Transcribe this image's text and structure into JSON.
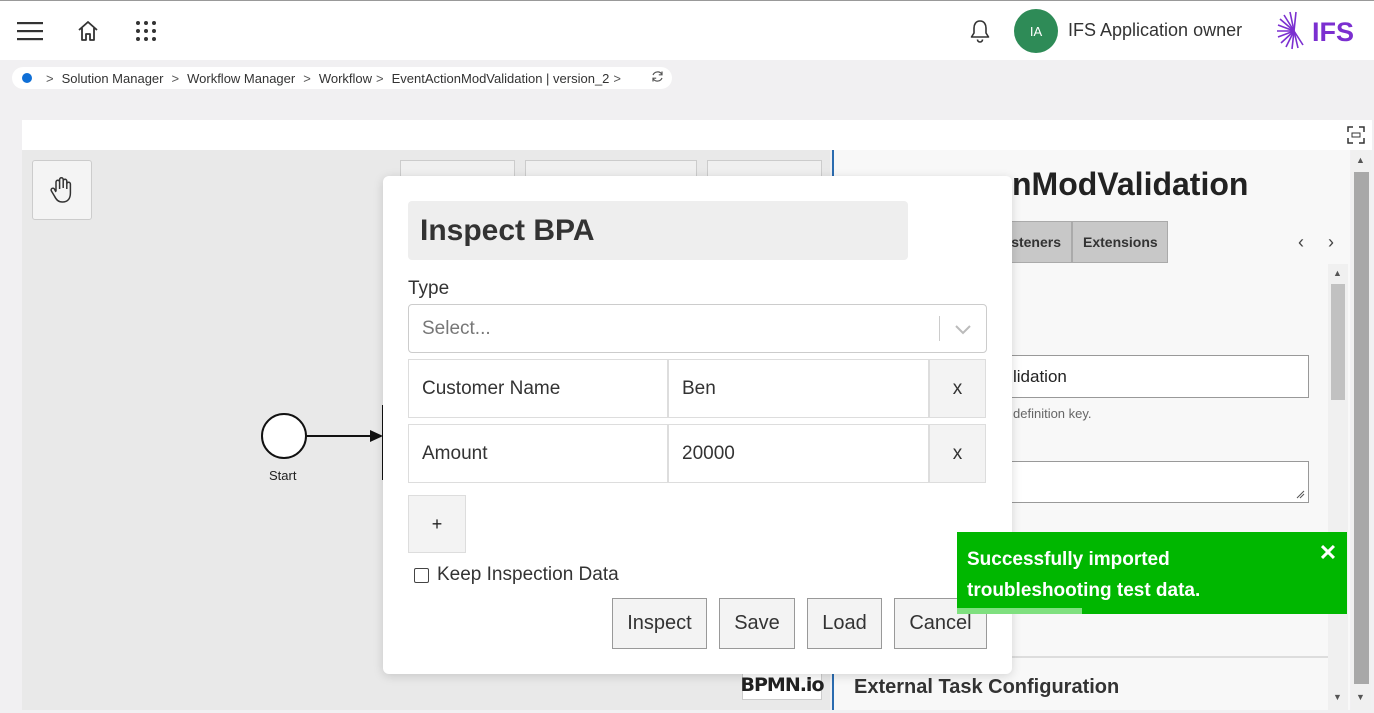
{
  "header": {
    "avatar_initials": "IA",
    "user_name": "IFS Application owner",
    "logo_text": "IFS",
    "logo_color": "#7b2fd0"
  },
  "breadcrumb": {
    "items": [
      "Solution Manager",
      "Workflow Manager",
      "Workflow",
      "EventActionModValidation | version_2"
    ]
  },
  "canvas": {
    "start_label": "Start",
    "bpmn_logo": "BPMN.io"
  },
  "properties": {
    "title": "EventActionModValidation",
    "visible_title": "nModValidation",
    "tabs": [
      "steners",
      "Extensions"
    ],
    "field_value": "lidation",
    "hint": "definition key.",
    "section_title": "External Task Configuration"
  },
  "modal": {
    "title": "Inspect BPA",
    "type_label": "Type",
    "type_placeholder": "Select...",
    "rows": [
      {
        "key": "Customer Name",
        "value": "Ben",
        "remove": "x"
      },
      {
        "key": "Amount",
        "value": "20000",
        "remove": "x"
      }
    ],
    "add_label": "+",
    "keep_label": "Keep Inspection Data",
    "keep_checked": false,
    "buttons": {
      "inspect": "Inspect",
      "save": "Save",
      "load": "Load",
      "cancel": "Cancel"
    }
  },
  "toast": {
    "message": "Successfully imported troubleshooting test data.",
    "close": "✕",
    "color": "#00b700"
  }
}
